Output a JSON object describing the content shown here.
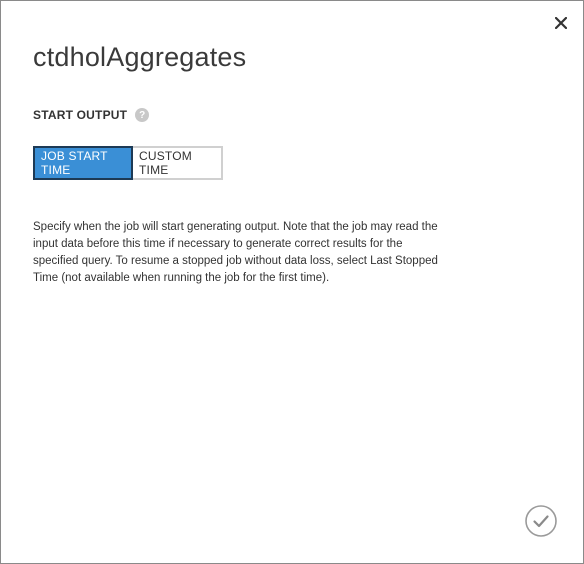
{
  "dialog": {
    "title": "ctdholAggregates",
    "close_icon": "close-icon",
    "confirm_icon": "checkmark-icon"
  },
  "start_output": {
    "label": "START OUTPUT",
    "help_icon_glyph": "?",
    "options": [
      {
        "label": "JOB START TIME",
        "selected": true
      },
      {
        "label": "CUSTOM TIME",
        "selected": false
      }
    ]
  },
  "description": "Specify when the job will start generating output. Note that the job may read the input data before this time if necessary to generate correct results for the specified query. To resume a stopped job without data loss, select Last Stopped Time (not available when running the job for the first time).",
  "colors": {
    "selected_bg": "#3a8fd6",
    "selected_border": "#1d3a55",
    "text": "#333333"
  }
}
